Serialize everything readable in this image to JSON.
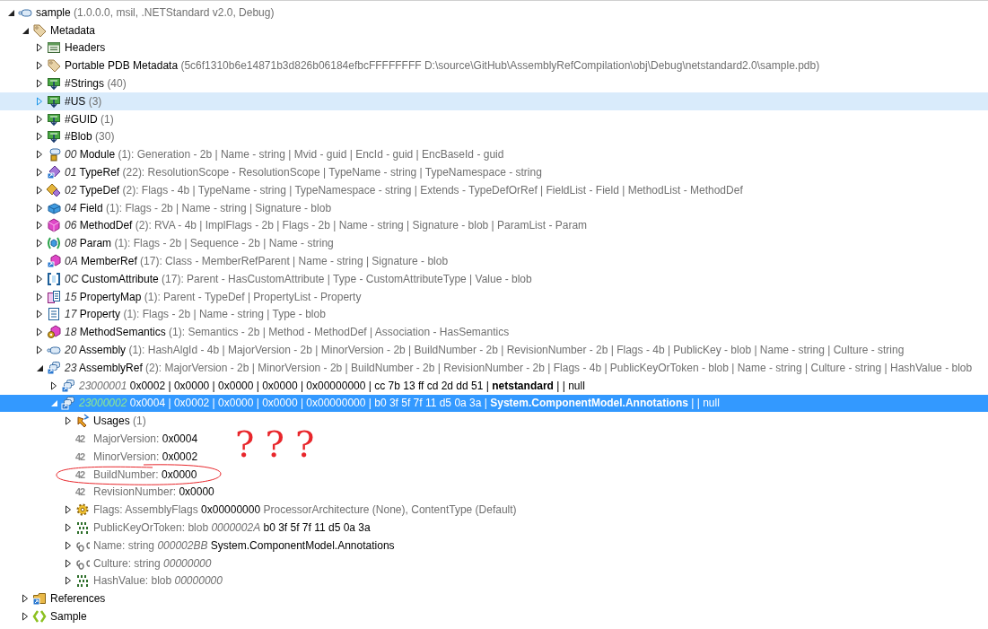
{
  "tree": [
    {
      "kind": "assembly",
      "expanded": true,
      "selected": false,
      "hovered": false,
      "parts": [
        {
          "kind": "plain",
          "text": "sample"
        },
        {
          "kind": "meta",
          "text": "(1.0.0.0, msil, .NETStandard v2.0, Debug)"
        }
      ],
      "children": [
        {
          "kind": "tag",
          "expanded": true,
          "selected": false,
          "hovered": false,
          "parts": [
            {
              "kind": "plain",
              "text": "Metadata"
            }
          ],
          "children": [
            {
              "kind": "headers",
              "expanded": false,
              "selected": false,
              "hovered": false,
              "parts": [
                {
                  "kind": "plain",
                  "text": "Headers"
                }
              ]
            },
            {
              "kind": "tag",
              "expanded": false,
              "selected": false,
              "hovered": false,
              "parts": [
                {
                  "kind": "plain",
                  "text": "Portable PDB Metadata"
                },
                {
                  "kind": "meta",
                  "text": "(5c6f1310b6e14871b3d826b06184efbcFFFFFFFF D:\\source\\GitHub\\AssemblyRefCompilation\\obj\\Debug\\netstandard2.0\\sample.pdb)"
                }
              ]
            },
            {
              "kind": "heap",
              "expanded": false,
              "selected": false,
              "hovered": false,
              "parts": [
                {
                  "kind": "plain",
                  "text": "#Strings"
                },
                {
                  "kind": "meta",
                  "text": "(40)"
                }
              ]
            },
            {
              "kind": "heap",
              "expanded": false,
              "selected": false,
              "hovered": true,
              "parts": [
                {
                  "kind": "plain",
                  "text": "#US"
                },
                {
                  "kind": "meta",
                  "text": "(3)"
                }
              ]
            },
            {
              "kind": "heap",
              "expanded": false,
              "selected": false,
              "hovered": false,
              "parts": [
                {
                  "kind": "plain",
                  "text": "#GUID"
                },
                {
                  "kind": "meta",
                  "text": "(1)"
                }
              ]
            },
            {
              "kind": "heap",
              "expanded": false,
              "selected": false,
              "hovered": false,
              "parts": [
                {
                  "kind": "plain",
                  "text": "#Blob"
                },
                {
                  "kind": "meta",
                  "text": "(30)"
                }
              ]
            },
            {
              "kind": "module",
              "expanded": false,
              "selected": false,
              "hovered": false,
              "parts": [
                {
                  "kind": "index",
                  "text": "00"
                },
                {
                  "kind": "plain",
                  "text": "Module"
                },
                {
                  "kind": "meta",
                  "text": "(1): Generation - 2b | Name - string | Mvid - guid | EncId - guid | EncBaseId - guid"
                }
              ]
            },
            {
              "kind": "typeref",
              "expanded": false,
              "selected": false,
              "hovered": false,
              "parts": [
                {
                  "kind": "index",
                  "text": "01"
                },
                {
                  "kind": "plain",
                  "text": "TypeRef"
                },
                {
                  "kind": "meta",
                  "text": "(22): ResolutionScope - ResolutionScope | TypeName - string | TypeNamespace - string"
                }
              ]
            },
            {
              "kind": "typedef",
              "expanded": false,
              "selected": false,
              "hovered": false,
              "parts": [
                {
                  "kind": "index",
                  "text": "02"
                },
                {
                  "kind": "plain",
                  "text": "TypeDef"
                },
                {
                  "kind": "meta",
                  "text": "(2): Flags - 4b | TypeName - string | TypeNamespace - string | Extends - TypeDefOrRef | FieldList - Field | MethodList - MethodDef"
                }
              ]
            },
            {
              "kind": "field",
              "expanded": false,
              "selected": false,
              "hovered": false,
              "parts": [
                {
                  "kind": "index",
                  "text": "04"
                },
                {
                  "kind": "plain",
                  "text": "Field"
                },
                {
                  "kind": "meta",
                  "text": "(1): Flags - 2b | Name - string | Signature - blob"
                }
              ]
            },
            {
              "kind": "methoddef",
              "expanded": false,
              "selected": false,
              "hovered": false,
              "parts": [
                {
                  "kind": "index",
                  "text": "06"
                },
                {
                  "kind": "plain",
                  "text": "MethodDef"
                },
                {
                  "kind": "meta",
                  "text": "(2): RVA - 4b | ImplFlags - 2b | Flags - 2b | Name - string | Signature - blob | ParamList - Param"
                }
              ]
            },
            {
              "kind": "param",
              "expanded": false,
              "selected": false,
              "hovered": false,
              "parts": [
                {
                  "kind": "index",
                  "text": "08"
                },
                {
                  "kind": "plain",
                  "text": "Param"
                },
                {
                  "kind": "meta",
                  "text": "(1): Flags - 2b | Sequence - 2b | Name - string"
                }
              ]
            },
            {
              "kind": "memberref",
              "expanded": false,
              "selected": false,
              "hovered": false,
              "parts": [
                {
                  "kind": "index",
                  "text": "0A"
                },
                {
                  "kind": "plain",
                  "text": "MemberRef"
                },
                {
                  "kind": "meta",
                  "text": "(17): Class - MemberRefParent | Name - string | Signature - blob"
                }
              ]
            },
            {
              "kind": "customattribute",
              "expanded": false,
              "selected": false,
              "hovered": false,
              "parts": [
                {
                  "kind": "index",
                  "text": "0C"
                },
                {
                  "kind": "plain",
                  "text": "CustomAttribute"
                },
                {
                  "kind": "meta",
                  "text": "(17): Parent - HasCustomAttribute | Type - CustomAttributeType | Value - blob"
                }
              ]
            },
            {
              "kind": "propertymap",
              "expanded": false,
              "selected": false,
              "hovered": false,
              "parts": [
                {
                  "kind": "index",
                  "text": "15"
                },
                {
                  "kind": "plain",
                  "text": "PropertyMap"
                },
                {
                  "kind": "meta",
                  "text": "(1): Parent - TypeDef | PropertyList - Property"
                }
              ]
            },
            {
              "kind": "property",
              "expanded": false,
              "selected": false,
              "hovered": false,
              "parts": [
                {
                  "kind": "index",
                  "text": "17"
                },
                {
                  "kind": "plain",
                  "text": "Property"
                },
                {
                  "kind": "meta",
                  "text": "(1): Flags - 2b | Name - string | Type - blob"
                }
              ]
            },
            {
              "kind": "methodsemantics",
              "expanded": false,
              "selected": false,
              "hovered": false,
              "parts": [
                {
                  "kind": "index",
                  "text": "18"
                },
                {
                  "kind": "plain",
                  "text": "MethodSemantics"
                },
                {
                  "kind": "meta",
                  "text": "(1): Semantics - 2b | Method - MethodDef | Association - HasSemantics"
                }
              ]
            },
            {
              "kind": "assembly",
              "expanded": false,
              "selected": false,
              "hovered": false,
              "parts": [
                {
                  "kind": "index",
                  "text": "20"
                },
                {
                  "kind": "plain",
                  "text": "Assembly"
                },
                {
                  "kind": "meta",
                  "text": "(1): HashAlgId - 4b | MajorVersion - 2b | MinorVersion - 2b | BuildNumber - 2b | RevisionNumber - 2b | Flags - 4b | PublicKey - blob | Name - string | Culture - string"
                }
              ]
            },
            {
              "kind": "assemblyref",
              "expanded": true,
              "selected": false,
              "hovered": false,
              "parts": [
                {
                  "kind": "index",
                  "text": "23"
                },
                {
                  "kind": "plain",
                  "text": "AssemblyRef"
                },
                {
                  "kind": "meta",
                  "text": "(2): MajorVersion - 2b | MinorVersion - 2b | BuildNumber - 2b | RevisionNumber - 2b | Flags - 4b | PublicKeyOrToken - blob | Name - string | Culture - string | HashValue - blob"
                }
              ],
              "children": [
                {
                  "kind": "assemblyref",
                  "expanded": false,
                  "selected": false,
                  "hovered": false,
                  "parts": [
                    {
                      "kind": "token",
                      "text": "23000001"
                    },
                    {
                      "kind": "plain",
                      "text": "0x0002 | 0x0000 | 0x0000 | 0x0000 | 0x00000000 | cc 7b 13 ff cd 2d dd 51 |"
                    },
                    {
                      "kind": "bold",
                      "text": "netstandard"
                    },
                    {
                      "kind": "plain",
                      "text": "|  | null"
                    }
                  ]
                },
                {
                  "kind": "assemblyref",
                  "expanded": true,
                  "selected": true,
                  "hovered": false,
                  "parts": [
                    {
                      "kind": "token",
                      "text": "23000002"
                    },
                    {
                      "kind": "plain",
                      "text": "0x0004 | 0x0002 | 0x0000 | 0x0000 | 0x00000000 | b0 3f 5f 7f 11 d5 0a 3a |"
                    },
                    {
                      "kind": "bold",
                      "text": "System.ComponentModel.Annotations"
                    },
                    {
                      "kind": "plain",
                      "text": "|  | null"
                    }
                  ],
                  "children": [
                    {
                      "kind": "usages",
                      "expanded": false,
                      "selected": false,
                      "hovered": false,
                      "parts": [
                        {
                          "kind": "plain",
                          "text": "Usages"
                        },
                        {
                          "kind": "meta",
                          "text": "(1)"
                        }
                      ]
                    },
                    {
                      "kind": "number",
                      "glyph": "42",
                      "selected": false,
                      "hovered": false,
                      "parts": [
                        {
                          "kind": "meta",
                          "text": "MajorVersion:"
                        },
                        {
                          "kind": "plain",
                          "text": "0x0004"
                        }
                      ]
                    },
                    {
                      "kind": "number",
                      "glyph": "42",
                      "selected": false,
                      "hovered": false,
                      "parts": [
                        {
                          "kind": "meta",
                          "text": "MinorVersion:"
                        },
                        {
                          "kind": "plain",
                          "text": "0x0002"
                        }
                      ]
                    },
                    {
                      "kind": "number",
                      "glyph": "42",
                      "selected": false,
                      "hovered": false,
                      "circled": true,
                      "parts": [
                        {
                          "kind": "meta",
                          "text": "BuildNumber:"
                        },
                        {
                          "kind": "plain",
                          "text": "0x0000"
                        }
                      ]
                    },
                    {
                      "kind": "number",
                      "glyph": "42",
                      "selected": false,
                      "hovered": false,
                      "parts": [
                        {
                          "kind": "meta",
                          "text": "RevisionNumber:"
                        },
                        {
                          "kind": "plain",
                          "text": "0x0000"
                        }
                      ]
                    },
                    {
                      "kind": "flags",
                      "expanded": false,
                      "selected": false,
                      "hovered": false,
                      "parts": [
                        {
                          "kind": "meta",
                          "text": "Flags: AssemblyFlags"
                        },
                        {
                          "kind": "plain",
                          "text": "0x00000000"
                        },
                        {
                          "kind": "meta",
                          "text": "ProcessorArchitecture (None), ContentType (Default)"
                        }
                      ]
                    },
                    {
                      "kind": "blob",
                      "expanded": false,
                      "selected": false,
                      "hovered": false,
                      "parts": [
                        {
                          "kind": "meta",
                          "text": "PublicKeyOrToken: blob"
                        },
                        {
                          "kind": "offset",
                          "text": "0000002A"
                        },
                        {
                          "kind": "plain",
                          "text": "b0 3f 5f 7f 11 d5 0a 3a"
                        }
                      ]
                    },
                    {
                      "kind": "string",
                      "expanded": false,
                      "selected": false,
                      "hovered": false,
                      "parts": [
                        {
                          "kind": "meta",
                          "text": "Name: string"
                        },
                        {
                          "kind": "offset",
                          "text": "000002BB"
                        },
                        {
                          "kind": "plain",
                          "text": "System.ComponentModel.Annotations"
                        }
                      ]
                    },
                    {
                      "kind": "string",
                      "expanded": false,
                      "selected": false,
                      "hovered": false,
                      "parts": [
                        {
                          "kind": "meta",
                          "text": "Culture: string"
                        },
                        {
                          "kind": "offset",
                          "text": "00000000"
                        }
                      ]
                    },
                    {
                      "kind": "blob",
                      "expanded": false,
                      "selected": false,
                      "hovered": false,
                      "parts": [
                        {
                          "kind": "meta",
                          "text": "HashValue: blob"
                        },
                        {
                          "kind": "offset",
                          "text": "00000000"
                        }
                      ]
                    }
                  ]
                }
              ]
            }
          ]
        },
        {
          "kind": "references",
          "expanded": false,
          "selected": false,
          "hovered": false,
          "parts": [
            {
              "kind": "plain",
              "text": "References"
            }
          ]
        },
        {
          "kind": "namespace",
          "expanded": false,
          "selected": false,
          "hovered": false,
          "parts": [
            {
              "kind": "plain",
              "text": "Sample"
            }
          ]
        }
      ]
    }
  ],
  "annotation": {
    "text": "???"
  }
}
